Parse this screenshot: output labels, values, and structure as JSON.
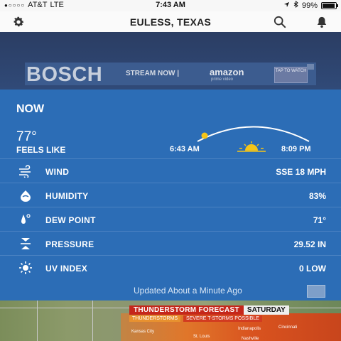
{
  "status_bar": {
    "carrier": "AT&T",
    "network": "LTE",
    "time": "7:43 AM",
    "battery": "99%"
  },
  "header": {
    "location": "EULESS, TEXAS",
    "icons": [
      "gear-icon",
      "search-icon",
      "bell-icon"
    ]
  },
  "ad": {
    "brand": "BOSCH",
    "stream_text": "STREAM NOW |",
    "amazon": "amazon",
    "amazon_sub": "prime video",
    "cta": "TAP TO WATCH"
  },
  "now": {
    "title": "NOW",
    "temperature": "77°",
    "feels_like_label": "FEELS LIKE",
    "sunrise": "6:43 AM",
    "sunset": "8:09 PM",
    "rows": [
      {
        "label": "WIND",
        "value": "SSE 18 MPH",
        "icon": "wind-icon"
      },
      {
        "label": "HUMIDITY",
        "value": "83%",
        "icon": "humidity-drop-icon"
      },
      {
        "label": "DEW POINT",
        "value": "71°",
        "icon": "dew-point-icon"
      },
      {
        "label": "PRESSURE",
        "value": "29.52 IN",
        "icon": "pressure-icon"
      },
      {
        "label": "UV INDEX",
        "value": "0 LOW",
        "icon": "uv-sun-icon"
      }
    ],
    "updated": "Updated About a Minute Ago"
  },
  "map": {
    "forecast_title": "THUNDERSTORM FORECAST",
    "forecast_day": "SATURDAY",
    "legend": [
      "THUNDERSTORMS",
      "SEVERE T-STORMS POSSIBLE"
    ],
    "cities": [
      "Kansas City",
      "St. Louis",
      "Indianapolis",
      "Cincinnati",
      "Nashville"
    ]
  },
  "colors": {
    "panel": "#2c6db6",
    "ad_bg": "#304a78",
    "header_bg": "#fafafa"
  }
}
